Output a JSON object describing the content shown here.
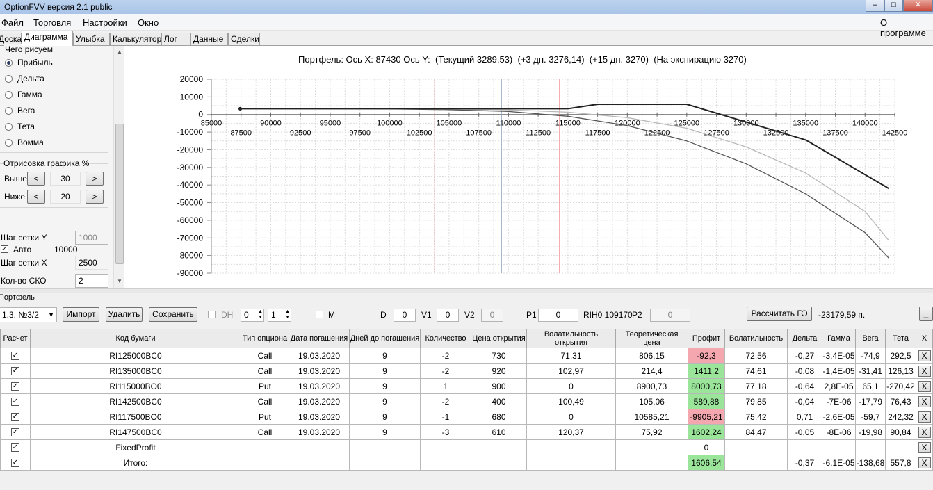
{
  "window": {
    "title": "OptionFVV версия 2.1 public"
  },
  "menu": {
    "items": [
      "Файл",
      "Торговля",
      "Настройки",
      "Окно"
    ],
    "about": "О программе"
  },
  "tabs": [
    "Доска",
    "Диаграмма",
    "Улыбка",
    "Калькулятор",
    "Лог",
    "Данные",
    "Сделки"
  ],
  "left_panel": {
    "group_title": "Чего рисуем",
    "radios": [
      {
        "label": "Прибыль",
        "checked": true
      },
      {
        "label": "Дельта",
        "checked": false
      },
      {
        "label": "Гамма",
        "checked": false
      },
      {
        "label": "Вега",
        "checked": false
      },
      {
        "label": "Тета",
        "checked": false
      },
      {
        "label": "Вомма",
        "checked": false
      }
    ],
    "render_title": "Отрисовка графика %",
    "above_label": "Выше",
    "above_value": "30",
    "below_label": "Ниже",
    "below_value": "20",
    "left_arrow": "<",
    "right_arrow": ">",
    "grid_y_label": "Шаг сетки Y",
    "grid_y_value": "1000",
    "auto_label": "Авто",
    "auto_value": "10000",
    "grid_x_label": "Шаг сетки X",
    "grid_x_value": "2500",
    "sko_label": "Кол-во СКО",
    "sko_value": "2"
  },
  "chart_header": "Портфель: Ось X: 87430 Ось Y:  (Текущий 3289,53)  (+3 дн. 3276,14)  (+15 дн. 3270)  (На экспирацию 3270)",
  "chart_data": {
    "type": "line",
    "xlim": [
      85000,
      142500
    ],
    "ylim": [
      -90000,
      20000
    ],
    "y_ticks": [
      20000,
      10000,
      0,
      -10000,
      -20000,
      -30000,
      -40000,
      -50000,
      -60000,
      -70000,
      -80000,
      -90000
    ],
    "x_ticks_upper": [
      85000,
      90000,
      95000,
      100000,
      105000,
      110000,
      115000,
      120000,
      125000,
      130000,
      135000,
      140000
    ],
    "x_ticks_lower": [
      87500,
      92500,
      97500,
      102500,
      107500,
      112500,
      117500,
      122500,
      127500,
      132500,
      137500,
      142500
    ],
    "vlines": [
      {
        "x": 103800,
        "color": "#f08c8c"
      },
      {
        "x": 109400,
        "color": "#8c9fb8"
      },
      {
        "x": 114300,
        "color": "#f08c8c"
      }
    ],
    "series": [
      {
        "color": "#222222",
        "width": 2,
        "points": [
          [
            87430,
            3290
          ],
          [
            115000,
            3270
          ],
          [
            117500,
            5800
          ],
          [
            125000,
            5800
          ],
          [
            135000,
            -14400
          ],
          [
            142000,
            -42000
          ]
        ]
      },
      {
        "color": "#b8b8b8",
        "width": 1.3,
        "points": [
          [
            87430,
            3270
          ],
          [
            100000,
            3230
          ],
          [
            105000,
            3050
          ],
          [
            110000,
            2600
          ],
          [
            115000,
            1300
          ],
          [
            120000,
            -1800
          ],
          [
            125000,
            -7800
          ],
          [
            130000,
            -18400
          ],
          [
            135000,
            -33200
          ],
          [
            140000,
            -55000
          ],
          [
            142000,
            -71500
          ]
        ]
      },
      {
        "color": "#555555",
        "width": 1.3,
        "points": [
          [
            87430,
            3250
          ],
          [
            100000,
            3150
          ],
          [
            105000,
            2750
          ],
          [
            110000,
            1700
          ],
          [
            115000,
            -1000
          ],
          [
            120000,
            -6300
          ],
          [
            125000,
            -15000
          ],
          [
            130000,
            -28000
          ],
          [
            135000,
            -45000
          ],
          [
            140000,
            -67000
          ],
          [
            142000,
            -81500
          ]
        ]
      }
    ]
  },
  "portfolio": {
    "section_label": "Портфель",
    "selector_value": "1.3. №3/2",
    "import_label": "Импорт",
    "delete_label": "Удалить",
    "save_label": "Сохранить",
    "dh_label": "DH",
    "spin1": "0",
    "spin2": "1",
    "m_label": "M",
    "d_label": "D",
    "d_value": "0",
    "v1_label": "V1",
    "v1_value": "0",
    "v2_label": "V2",
    "v2_value": "0",
    "p1_label": "P1",
    "p1_value": "0",
    "rih_label": "RIH0 109170",
    "p2_label": "P2",
    "p2_value": "0",
    "calc_go_label": "Рассчитать ГО",
    "go_value": "-23179,59 п.",
    "minimize_label": "_"
  },
  "table": {
    "headers": [
      "Расчет",
      "Код бумаги",
      "Тип опциона",
      "Дата погашения",
      "Дней до погашения",
      "Количество",
      "Цена открытия",
      "Волатильность открытия",
      "Теоретическая цена",
      "Профит",
      "Волатильность",
      "Дельта",
      "Гамма",
      "Вега",
      "Тета",
      "X"
    ],
    "rows": [
      {
        "code": "RI125000BC0",
        "type": "Call",
        "date": "19.03.2020",
        "days": "9",
        "qty": "-2",
        "price": "730",
        "vol_open": "71,31",
        "theo": "806,15",
        "profit": "-92,3",
        "profit_sign": "neg",
        "vol": "72,56",
        "delta": "-0,27",
        "gamma": "-3,4E-05",
        "vega": "-74,9",
        "theta": "292,5"
      },
      {
        "code": "RI135000BC0",
        "type": "Call",
        "date": "19.03.2020",
        "days": "9",
        "qty": "-2",
        "price": "920",
        "vol_open": "102,97",
        "theo": "214,4",
        "profit": "1411,2",
        "profit_sign": "pos",
        "vol": "74,61",
        "delta": "-0,08",
        "gamma": "-1,4E-05",
        "vega": "-31,41",
        "theta": "126,13"
      },
      {
        "code": "RI115000BO0",
        "type": "Put",
        "date": "19.03.2020",
        "days": "9",
        "qty": "1",
        "price": "900",
        "vol_open": "0",
        "theo": "8900,73",
        "profit": "8000,73",
        "profit_sign": "pos",
        "vol": "77,18",
        "delta": "-0,64",
        "gamma": "2,8E-05",
        "vega": "65,1",
        "theta": "-270,42"
      },
      {
        "code": "RI142500BC0",
        "type": "Call",
        "date": "19.03.2020",
        "days": "9",
        "qty": "-2",
        "price": "400",
        "vol_open": "100,49",
        "theo": "105,06",
        "profit": "589,88",
        "profit_sign": "pos",
        "vol": "79,85",
        "delta": "-0,04",
        "gamma": "-7E-06",
        "vega": "-17,79",
        "theta": "76,43"
      },
      {
        "code": "RI117500BO0",
        "type": "Put",
        "date": "19.03.2020",
        "days": "9",
        "qty": "-1",
        "price": "680",
        "vol_open": "0",
        "theo": "10585,21",
        "profit": "-9905,21",
        "profit_sign": "neg",
        "vol": "75,42",
        "delta": "0,71",
        "gamma": "-2,6E-05",
        "vega": "-59,7",
        "theta": "242,32"
      },
      {
        "code": "RI147500BC0",
        "type": "Call",
        "date": "19.03.2020",
        "days": "9",
        "qty": "-3",
        "price": "610",
        "vol_open": "120,37",
        "theo": "75,92",
        "profit": "1602,24",
        "profit_sign": "pos",
        "vol": "84,47",
        "delta": "-0,05",
        "gamma": "-8E-06",
        "vega": "-19,98",
        "theta": "90,84"
      }
    ],
    "fixed_profit": {
      "label": "FixedProfit",
      "profit": "0"
    },
    "total": {
      "label": "Итого:",
      "profit": "1606,54",
      "delta": "-0,37",
      "gamma": "-6,1E-05",
      "vega": "-138,68",
      "theta": "557,8"
    },
    "x_label": "X",
    "check_mark": "✓"
  },
  "colors": {
    "profit_positive": "#9be59b",
    "profit_negative": "#f4a7ae"
  }
}
